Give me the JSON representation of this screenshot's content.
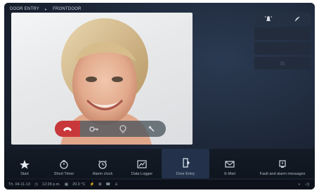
{
  "header": {
    "breadcrumb_1": "DOOR ENTRY",
    "separator": "▸",
    "breadcrumb_2": "FRONTDOOR"
  },
  "video": {
    "description": "video-feed"
  },
  "call_controls": {
    "icons": [
      "hangup-icon",
      "key-icon",
      "light-icon",
      "tool-icon"
    ],
    "hangup_color": "#c8383a"
  },
  "side_panel": {
    "icons": [
      "alarm-bell-icon",
      "mute-icon"
    ],
    "row2": "",
    "row3": "",
    "row4": "▯▯"
  },
  "nav": [
    {
      "label": "Start",
      "icon": "star-icon"
    },
    {
      "label": "Short Timer",
      "icon": "timer-icon"
    },
    {
      "label": "Alarm clock",
      "icon": "alarm-clock-icon"
    },
    {
      "label": "Data Logger",
      "icon": "chart-icon"
    },
    {
      "label": "Door Entry",
      "icon": "door-icon",
      "active": true
    },
    {
      "label": "E-Mail",
      "icon": "mail-icon"
    },
    {
      "label": "Fault and alarm messages",
      "icon": "alert-icon"
    }
  ],
  "status": {
    "date": "Th. 04-11-13",
    "time": "12:28 p.m.",
    "temp": "20.0 °C"
  }
}
